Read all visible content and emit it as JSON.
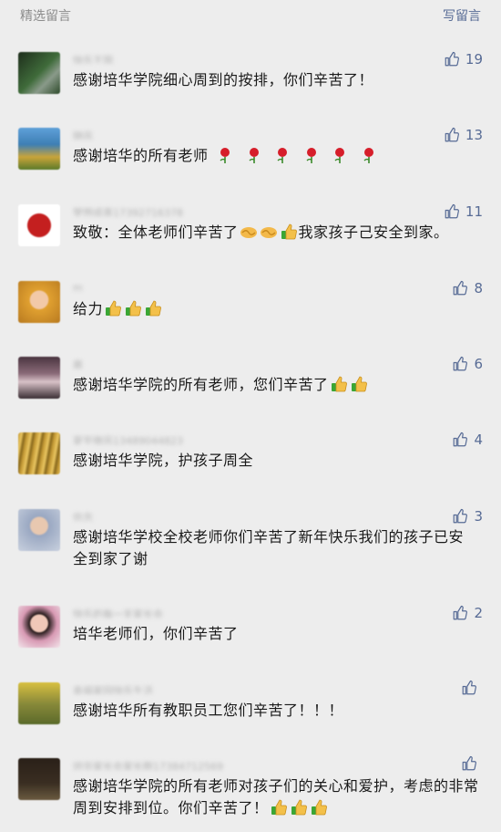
{
  "header": {
    "title": "精选留言",
    "write_label": "写留言"
  },
  "comments": [
    {
      "nick": "快乐王国",
      "text": "感谢培华学院细心周到的按排，你们辛苦了！",
      "likes": "19",
      "avatar": "#2d4a2a"
    },
    {
      "nick": "随风",
      "text": "感谢培华的所有老师",
      "likes": "13",
      "avatar": "#3e7fb5",
      "roses": 6
    },
    {
      "nick": "梦想成真17392716378",
      "text_a": "致敬：全体老师们辛苦了",
      "text_b": "我家孩子己安全到家。",
      "likes": "11",
      "avatar": "#c41f1f"
    },
    {
      "nick": "m",
      "text": "给力",
      "likes": "8",
      "avatar": "#d8a23b",
      "thumbs": 3
    },
    {
      "nick": "晨",
      "text": "感谢培华学院的所有老师，您们辛苦了",
      "likes": "6",
      "avatar": "#6b4a58",
      "thumbs": 2
    },
    {
      "nick": "夏至微风13489044823",
      "text": "感谢培华学院，护孩子周全",
      "likes": "4",
      "avatar": "#c49a36"
    },
    {
      "nick": "信念",
      "text": "感谢培华学校全校老师你们辛苦了新年快乐我们的孩子已安全到家了谢",
      "likes": "3",
      "avatar": "#9aa8c2"
    },
    {
      "nick": "快乐的每一天家长会",
      "text": "培华老师们，你们辛苦了",
      "likes": "2",
      "avatar": "#d89ab4"
    },
    {
      "nick": "幸福家园快乐生活",
      "text": "感谢培华所有教职员工您们辛苦了！！！",
      "likes": "",
      "avatar": "#8a8a3a"
    },
    {
      "nick": "培华家长会家长群17384712569",
      "text": "感谢培华学院的所有老师对孩子们的关心和爱护，考虑的非常周到安排到位。你们辛苦了！",
      "likes": "",
      "avatar": "#3a2e22",
      "thumbs": 3
    }
  ],
  "icons": {
    "like": "thumbs-up-outline-icon",
    "accent": "#576b95"
  }
}
